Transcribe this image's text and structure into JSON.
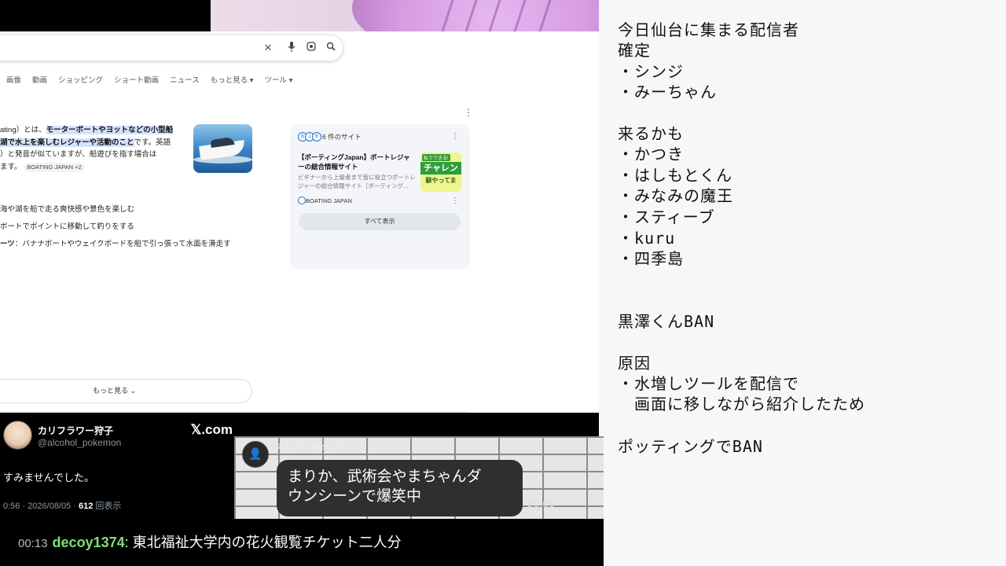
{
  "google": {
    "tabs": [
      "画像",
      "動画",
      "ショッピング",
      "ショート動画",
      "ニュース",
      "もっと見る ▾",
      "ツール ▾"
    ],
    "snippet": {
      "l1a": "ating）とは、",
      "l1b": "モーターボートやヨットなどの小型船",
      "l2a": "湖で水上を楽しむレジャーや活動のこと",
      "l2b": "です。英語",
      "l3": "）と発音が似ていますが、船遊びを指す場合は",
      "l4": "ます。",
      "source": "BOATING JAPAN +2"
    },
    "bullets": [
      {
        "bold": "",
        "text": "海や湖を船で走る爽快感や景色を楽しむ"
      },
      {
        "bold": "",
        "text": "ボートでポイントに移動して釣りをする"
      },
      {
        "bold": "ーツ",
        "text": "：バナナボートやウェイクボードを船で引っ張って水面を滑走す"
      }
    ],
    "more_button": "もっと見る",
    "side_card": {
      "count": "6 件のサイト",
      "title": "【ボーティングJapan】ボートレジャーの総合情報サイト",
      "desc": "ビギナーから上級者まで皆に役立つボートレジャーの総合情報サイト［ボーティング...",
      "thumb_tag": "私でできる!",
      "thumb_main": "チャレン",
      "thumb_sub": "験やってま",
      "source": "BOATING JAPAN",
      "show_all": "すべて表示"
    }
  },
  "notes": [
    "今日仙台に集まる配信者",
    "確定",
    "・シンジ",
    "・みーちゃん",
    "来るかも",
    "・かつき",
    "・はしもとくん",
    "・みなみの魔王",
    "・スティーブ",
    "・kuru",
    "・四季島",
    "黒澤くんBAN",
    "原因",
    "・水増しツールを配信で",
    "　画面に移しながら紹介したため",
    "ポッティングでBAN"
  ],
  "tweet": {
    "name": "カリフラワー狩子",
    "handle": "@alcohol_pokemon",
    "site": "𝕏.com",
    "body": "すみませんでした。",
    "meta_prefix": "0:56 · 2026/08/05 · ",
    "views": "612",
    "views_suffix": " 回表示"
  },
  "comment": {
    "username": "めだか　ver.ポセイドン",
    "message_line1": "まりか、武術会やまちゃんダ",
    "message_line2": "ウンシーンで爆笑中",
    "time": "20:01"
  },
  "chat": {
    "time": "00:13",
    "user": "decoy1374",
    "message": ": 東北福祉大学内の花火観覧チケット二人分"
  }
}
